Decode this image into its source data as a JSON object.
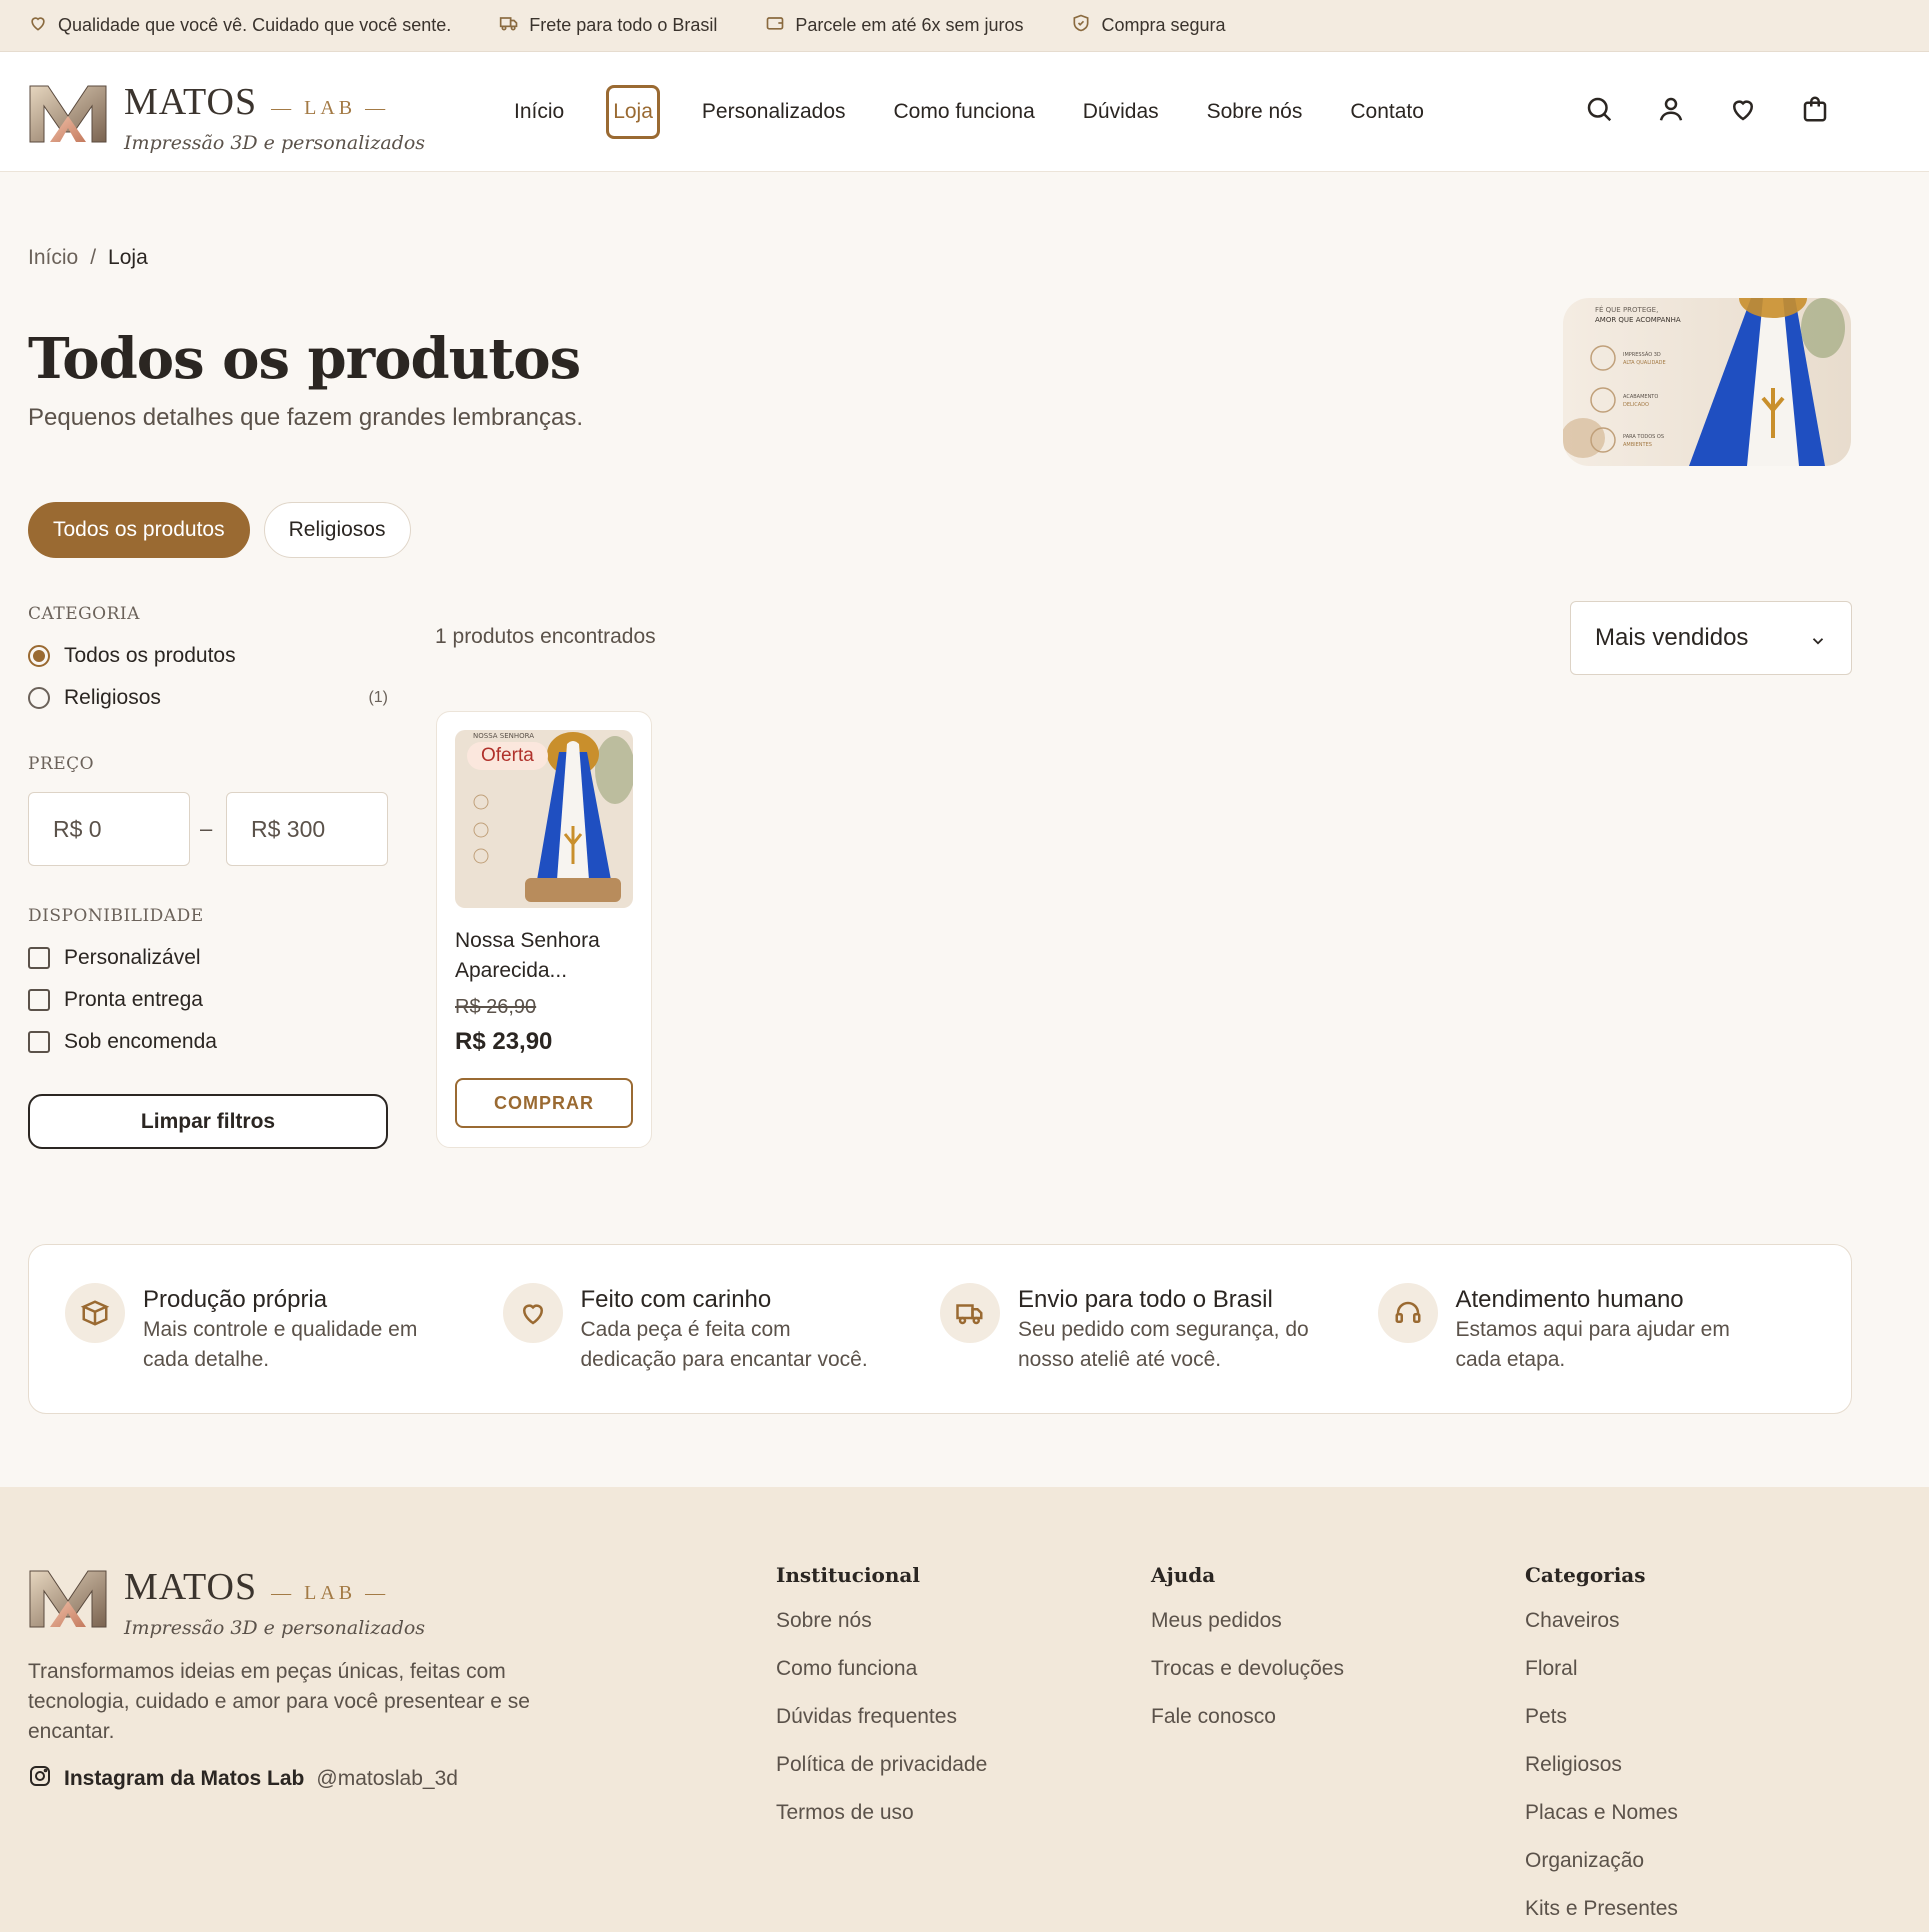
{
  "topbar": {
    "items": [
      {
        "icon": "heart-icon",
        "text": "Qualidade que você vê. Cuidado que você sente."
      },
      {
        "icon": "truck-icon",
        "text": "Frete para todo o Brasil"
      },
      {
        "icon": "wallet-icon",
        "text": "Parcele em até 6x sem juros"
      },
      {
        "icon": "shield-icon",
        "text": "Compra segura"
      }
    ]
  },
  "brand": {
    "name": "MATOS",
    "suffix": "— LAB —",
    "tagline": "Impressão 3D e personalizados"
  },
  "nav": {
    "items": [
      "Início",
      "Loja",
      "Personalizados",
      "Como funciona",
      "Dúvidas",
      "Sobre nós",
      "Contato"
    ],
    "active": "Loja"
  },
  "header_icons": [
    "search-icon",
    "user-icon",
    "heart-icon",
    "bag-icon"
  ],
  "breadcrumb": {
    "home": "Início",
    "sep": "/",
    "current": "Loja"
  },
  "page": {
    "title": "Todos os produtos",
    "subtitle": "Pequenos detalhes que fazem grandes lembranças."
  },
  "banner": {
    "line1": "FÉ QUE PROTEGE,",
    "line2": "AMOR QUE ACOMPANHA",
    "feat1": "IMPRESSÃO 3D",
    "feat1b": "ALTA QUALIDADE",
    "feat2": "ACABAMENTO",
    "feat2b": "DELICADO",
    "feat3": "PARA TODOS OS",
    "feat3b": "AMBIENTES"
  },
  "pills": {
    "all": "Todos os produtos",
    "religious": "Religiosos"
  },
  "filters": {
    "category_heading": "CATEGORIA",
    "categories": [
      {
        "label": "Todos os produtos",
        "count": "",
        "selected": true
      },
      {
        "label": "Religiosos",
        "count": "(1)",
        "selected": false
      }
    ],
    "price_heading": "PREÇO",
    "price_min_placeholder": "R$ 0",
    "price_sep": "–",
    "price_max_placeholder": "R$ 300",
    "availability_heading": "DISPONIBILIDADE",
    "availability": [
      "Personalizável",
      "Pronta entrega",
      "Sob encomenda"
    ],
    "clear": "Limpar filtros"
  },
  "results": {
    "found": "1 produtos encontrados",
    "sort": "Mais vendidos"
  },
  "product": {
    "badge": "Oferta",
    "name": "Nossa Senhora Aparecida...",
    "old_price": "R$ 26,90",
    "price": "R$ 23,90",
    "buy": "COMPRAR",
    "thumb_text": "NOSSA SENHORA"
  },
  "features": [
    {
      "icon": "box-icon",
      "title": "Produção própria",
      "desc": "Mais controle e qualidade em cada detalhe."
    },
    {
      "icon": "heart-icon",
      "title": "Feito com carinho",
      "desc": "Cada peça é feita com dedicação para encantar você."
    },
    {
      "icon": "truck-icon",
      "title": "Envio para todo o Brasil",
      "desc": "Seu pedido com segurança, do nosso ateliê até você."
    },
    {
      "icon": "headset-icon",
      "title": "Atendimento humano",
      "desc": "Estamos aqui para ajudar em cada etapa."
    }
  ],
  "footer": {
    "description": "Transformamos ideias em peças únicas, feitas com tecnologia, cuidado e amor para você presentear e se encantar.",
    "instagram_label": "Instagram da Matos Lab",
    "instagram_handle": "@matoslab_3d",
    "institucional": {
      "title": "Institucional",
      "links": [
        "Sobre nós",
        "Como funciona",
        "Dúvidas frequentes",
        "Política de privacidade",
        "Termos de uso"
      ]
    },
    "ajuda": {
      "title": "Ajuda",
      "links": [
        "Meus pedidos",
        "Trocas e devoluções",
        "Fale conosco"
      ]
    },
    "categorias": {
      "title": "Categorias",
      "links": [
        "Chaveiros",
        "Floral",
        "Pets",
        "Religiosos",
        "Placas e Nomes",
        "Organização",
        "Kits e Presentes"
      ]
    }
  },
  "colors": {
    "accent": "#9a6a32",
    "background": "#faf7f3",
    "footer": "#f2e8da",
    "offer": "#b0312b"
  }
}
